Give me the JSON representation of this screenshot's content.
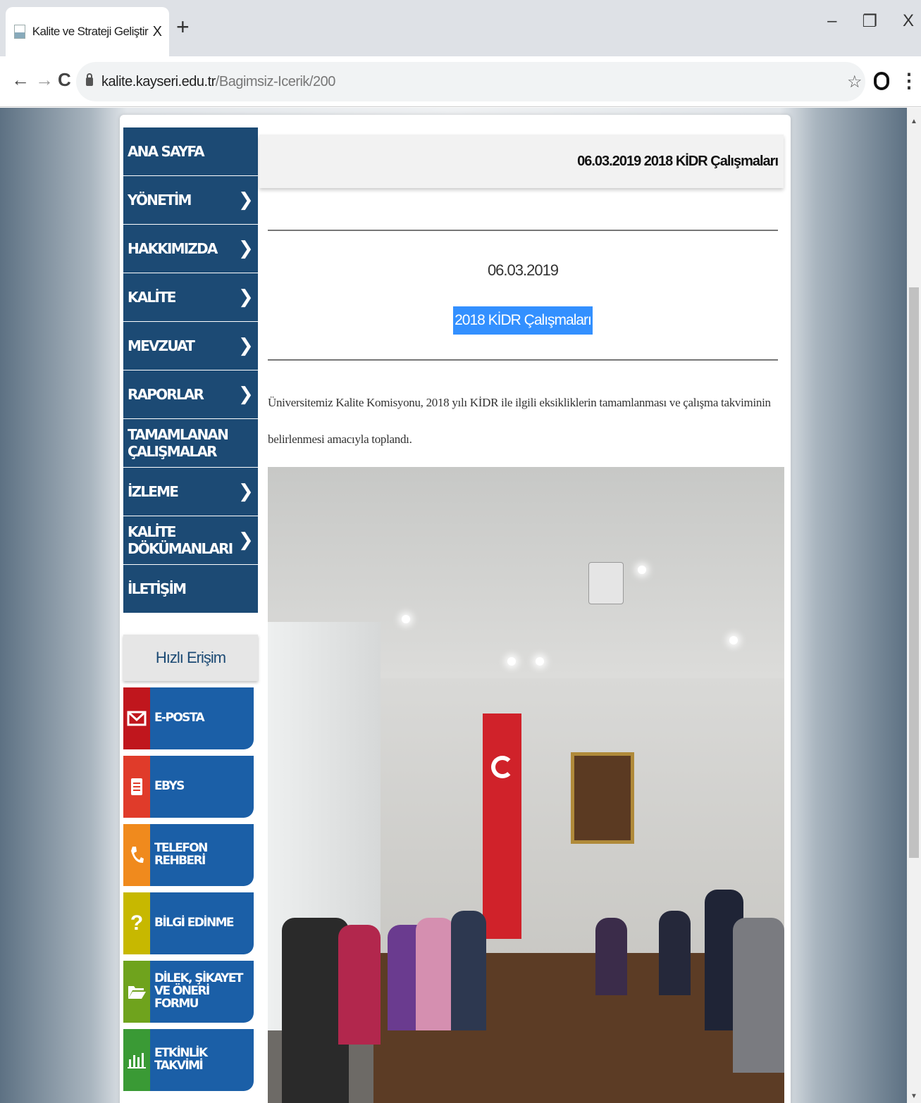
{
  "browser": {
    "tab_title": "Kalite ve Strateji Geliştirme Uygu",
    "tab_close": "X",
    "new_tab": "+",
    "window_controls": {
      "minimize": "–",
      "restore": "❐",
      "close": "X"
    },
    "nav": {
      "back": "←",
      "forward": "→",
      "reload": "C"
    },
    "url_host": "kalite.kayseri.edu.tr",
    "url_path": "/Bagimsiz-Icerik/200",
    "star": "☆",
    "kebab": "⋮"
  },
  "sidebar": {
    "menu": [
      {
        "label": "ANA SAYFA",
        "has_submenu": false
      },
      {
        "label": "YÖNETİM",
        "has_submenu": true
      },
      {
        "label": "HAKKIMIZDA",
        "has_submenu": true
      },
      {
        "label": "KALİTE",
        "has_submenu": true
      },
      {
        "label": "MEVZUAT",
        "has_submenu": true
      },
      {
        "label": "RAPORLAR",
        "has_submenu": true
      },
      {
        "label": "TAMAMLANAN ÇALIŞMALAR",
        "has_submenu": false
      },
      {
        "label": "İZLEME",
        "has_submenu": true
      },
      {
        "label": "KALİTE DÖKÜMANLARI",
        "has_submenu": true
      },
      {
        "label": "İLETİŞİM",
        "has_submenu": false
      }
    ],
    "chevron": "❯",
    "quick_access_title": "Hızlı Erişim",
    "quick_access": [
      {
        "label": "E-POSTA",
        "icon": "envelope-icon",
        "color": "#c0161d"
      },
      {
        "label": "EBYS",
        "icon": "document-icon",
        "color": "#e03b2a"
      },
      {
        "label": "TELEFON REHBERİ",
        "icon": "phone-icon",
        "color": "#f08a1d"
      },
      {
        "label": "BİLGİ EDİNME",
        "icon": "question-icon",
        "color": "#c7b800"
      },
      {
        "label": "DİLEK, ŞİKAYET VE ÖNERİ FORMU",
        "icon": "folder-icon",
        "color": "#6fa31d"
      },
      {
        "label": "ETKİNLİK TAKVİMİ",
        "icon": "chart-icon",
        "color": "#3a9a35"
      }
    ],
    "quick_glyphs": {
      "question": "?"
    }
  },
  "content": {
    "header_title": "06.03.2019 2018 KİDR Çalışmaları",
    "news_date": "06.03.2019",
    "news_title": "2018 KİDR Çalışmaları",
    "news_body": "Üniversitemiz Kalite Komisyonu, 2018 yılı KİDR ile ilgili eksikliklerin tamamlanması ve çalışma takviminin belirlenmesi amacıyla toplandı.",
    "photo_icon": "meeting-photo"
  },
  "colors": {
    "menu_bg": "#1c4a74",
    "quick_label_bg": "#1b5fa7",
    "selection": "#3390ff"
  }
}
